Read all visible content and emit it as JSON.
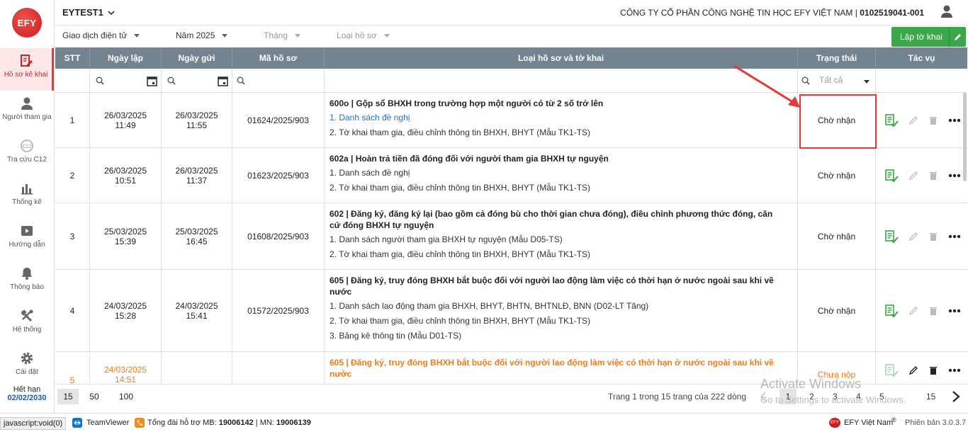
{
  "sidebar": {
    "logo": "EFY",
    "items": [
      {
        "label": "Hồ sơ kê khai",
        "icon": "form-edit-icon"
      },
      {
        "label": "Người tham gia",
        "icon": "person-icon"
      },
      {
        "label": "Tra cứu C12",
        "icon": "c12-lookup-icon"
      },
      {
        "label": "Thống kê",
        "icon": "bar-chart-icon"
      },
      {
        "label": "Hướng dẫn",
        "icon": "video-guide-icon"
      },
      {
        "label": "Thông báo",
        "icon": "bell-icon"
      },
      {
        "label": "Hệ thống",
        "icon": "tools-icon"
      },
      {
        "label": "Cài đặt",
        "icon": "gear-icon"
      }
    ],
    "expire_label": "Hết hạn",
    "expire_date": "02/02/2030"
  },
  "header": {
    "account": "EYTEST1",
    "company": "CÔNG TY CỔ PHẦN CÔNG NGHỆ TIN HỌC EFY VIỆT NAM |",
    "tax_code": "0102519041-001"
  },
  "filters": {
    "f1": "Giao dịch điện tử",
    "f2": "Năm 2025",
    "f3": "Tháng",
    "f4": "Loại hồ sơ",
    "new_button": "Lập tờ khai"
  },
  "table": {
    "headers": {
      "stt": "STT",
      "created": "Ngày lập",
      "sent": "Ngày gửi",
      "code": "Mã hồ sơ",
      "type": "Loại hồ sơ và tờ khai",
      "status": "Trạng thái",
      "actions": "Tác vụ"
    },
    "status_filter": "Tất cả",
    "rows": [
      {
        "stt": "1",
        "created_date": "26/03/2025",
        "created_time": "11:49",
        "sent_date": "26/03/2025",
        "sent_time": "11:55",
        "code": "01624/2025/903",
        "title": "600o | Gộp sổ BHXH trong trường hợp một người có từ 2 số trở lên",
        "lines": [
          "1. Danh sách đề nghị",
          "2. Tờ khai tham gia, điều chỉnh thông tin BHXH, BHYT (Mẫu TK1-TS)"
        ],
        "status": "Chờ nhận"
      },
      {
        "stt": "2",
        "created_date": "26/03/2025",
        "created_time": "10:51",
        "sent_date": "26/03/2025",
        "sent_time": "11:37",
        "code": "01623/2025/903",
        "title": "602a | Hoàn trả tiền đã đóng đối với người tham gia BHXH tự nguyện",
        "lines": [
          "1. Danh sách đề nghị",
          "2. Tờ khai tham gia, điều chỉnh thông tin BHXH, BHYT (Mẫu TK1-TS)"
        ],
        "status": "Chờ nhận"
      },
      {
        "stt": "3",
        "created_date": "25/03/2025",
        "created_time": "15:39",
        "sent_date": "25/03/2025",
        "sent_time": "16:45",
        "code": "01608/2025/903",
        "title": "602 | Đăng ký, đăng ký lại (bao gồm cả đóng bù cho thời gian chưa đóng), điều chỉnh phương thức đóng, căn cứ đóng BHXH tự nguyện",
        "lines": [
          "1. Danh sách người tham gia BHXH tự nguyện (Mẫu D05-TS)",
          "2. Tờ khai tham gia, điều chỉnh thông tin BHXH, BHYT (Mẫu TK1-TS)"
        ],
        "status": "Chờ nhận"
      },
      {
        "stt": "4",
        "created_date": "24/03/2025",
        "created_time": "15:28",
        "sent_date": "24/03/2025",
        "sent_time": "15:41",
        "code": "01572/2025/903",
        "title": "605 | Đăng ký, truy đóng BHXH bắt buộc đối với người lao động làm việc có thời hạn ở nước ngoài sau khi về nước",
        "lines": [
          "1. Danh sách lao động tham gia BHXH, BHYT, BHTN, BHTNLĐ, BNN (D02-LT Tăng)",
          "2. Tờ khai tham gia, điều chỉnh thông tin BHXH, BHYT (Mẫu TK1-TS)",
          "3. Bảng kê thông tin (Mẫu D01-TS)"
        ],
        "status": "Chờ nhận"
      },
      {
        "stt": "5",
        "created_date": "24/03/2025",
        "created_time": "14:51",
        "sent_date": "",
        "sent_time": "",
        "code": "",
        "title": "605 | Đăng ký, truy đóng BHXH bắt buộc đối với người lao động làm việc có thời hạn ở nước ngoài sau khi về nước",
        "lines": [],
        "status": "Chưa nộp"
      }
    ]
  },
  "pager": {
    "sizes": [
      "15",
      "50",
      "100"
    ],
    "info": "Trang 1 trong 15 trang của 222 dòng",
    "pages": [
      "1",
      "2",
      "3",
      "4",
      "5",
      "15"
    ]
  },
  "watermark": {
    "line1": "Activate Windows",
    "line2": "Go to Settings to activate Windows."
  },
  "statusbar": {
    "js": "javascript:void(0)",
    "teamviewer": "TeamViewer",
    "hotline_prefix": "Tổng đài hỗ trợ MB:",
    "mb": "19006142",
    "sep": "| MN:",
    "mn": "19006139",
    "brand": "EFY Việt Nam",
    "version": "Phiên bản 3.0.3.7"
  },
  "colors": {
    "accent": "#3ca64a",
    "header_bg": "#748390",
    "highlight": "#e53935",
    "pending": "#f07c1a"
  }
}
